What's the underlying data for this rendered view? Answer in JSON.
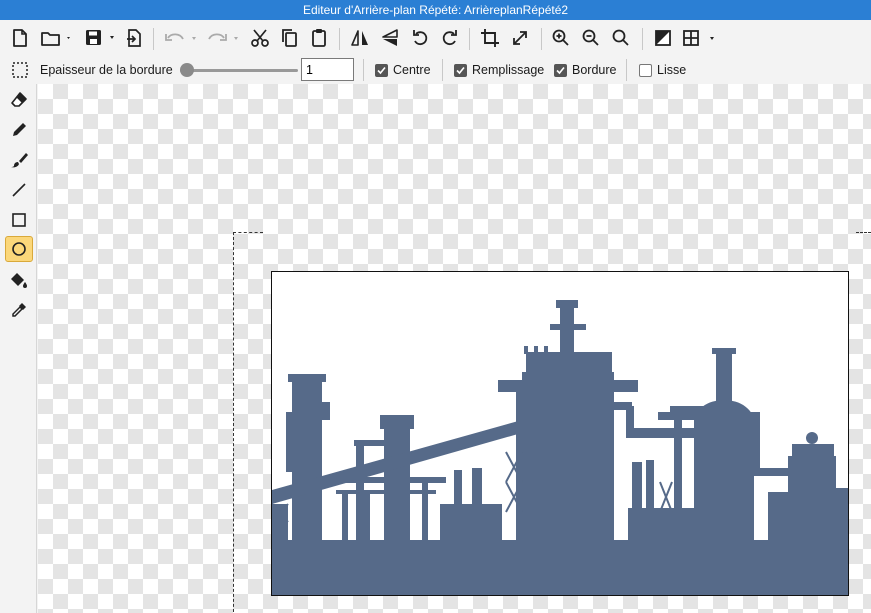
{
  "window": {
    "title": "Editeur d'Arrière-plan Répété: ArrièreplanRépété2"
  },
  "toolbar": {
    "icons": [
      "new-file-icon",
      "open-folder-icon",
      "save-icon",
      "export-icon",
      "undo-icon",
      "redo-icon",
      "cut-icon",
      "copy-icon",
      "paste-icon",
      "flip-horizontal-icon",
      "flip-vertical-icon",
      "rotate-left-icon",
      "rotate-right-icon",
      "crop-icon",
      "resize-icon",
      "zoom-in-icon",
      "zoom-out-icon",
      "zoom-fit-icon",
      "color-swap-icon",
      "grid-icon"
    ]
  },
  "options": {
    "border_width_label": "Epaisseur de la bordure",
    "border_width_value": "1",
    "border_width_level": 0.0,
    "centre_label": "Centre",
    "centre_checked": true,
    "fill_label": "Remplissage",
    "fill_checked": true,
    "border_label": "Bordure",
    "border_checked": true,
    "smooth_label": "Lisse",
    "smooth_checked": false
  },
  "tools": [
    {
      "name": "eraser-tool",
      "icon": "eraser-icon",
      "active": false
    },
    {
      "name": "pencil-tool",
      "icon": "pencil-icon",
      "active": false
    },
    {
      "name": "brush-tool",
      "icon": "brush-icon",
      "active": false
    },
    {
      "name": "line-tool",
      "icon": "line-icon",
      "active": false
    },
    {
      "name": "rectangle-tool",
      "icon": "rectangle-icon",
      "active": false
    },
    {
      "name": "ellipse-tool",
      "icon": "ellipse-icon",
      "active": true
    },
    {
      "name": "fill-tool",
      "icon": "paint-bucket-icon",
      "active": false
    },
    {
      "name": "eyedropper-tool",
      "icon": "eyedropper-icon",
      "active": false
    }
  ],
  "colors": {
    "title_bar": "#2b7fd4",
    "silhouette": "#566a89",
    "active_tool": "#fbd77a"
  }
}
